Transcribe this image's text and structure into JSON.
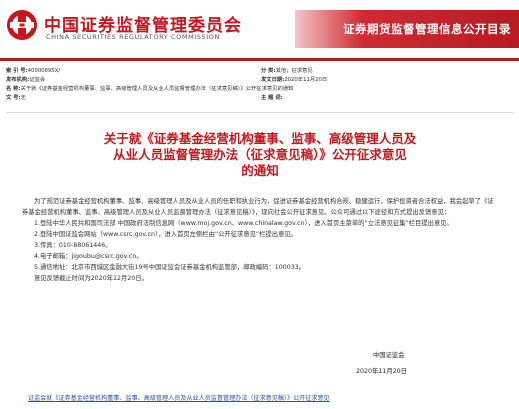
{
  "header": {
    "org_cn": "中国证券监督管理委员会",
    "org_en": "CHINA SECURITIES REGULATORY COMMISSION",
    "banner": "证券期货监督管理信息公开目录",
    "brand_color": "#c8161d"
  },
  "meta": {
    "index_label": "索 引 号:",
    "index_value": "40000895X/",
    "category_label": "分 类:",
    "category_value": "其他；征求意见",
    "issuer_label": "发布机构:",
    "issuer_value": "证监会",
    "date_label": "发文日期:",
    "date_value": "2020年11月20日",
    "name_label": "名 称:",
    "name_value": "关于就《证券基金经营机构董事、监事、高级管理人员及从业人员监督管理办法（征求意见稿）》公开征求意见的通知",
    "docno_label": "文 号:",
    "docno_value": "无",
    "subject_label": "主 题 词:",
    "subject_value": ""
  },
  "title": {
    "line1": "关于就《证券基金经营机构董事、监事、高级管理人员及",
    "line2": "从业人员监督管理办法（征求意见稿）》公开征求意见",
    "line3": "的通知"
  },
  "body": {
    "intro": "为了规范证券基金经营机构董事、监事、高级管理人员及从业人员的任职和执业行为，促进证券基金经营机构合规、稳健运行，保护投资者合法权益，我会起草了《证券基金经营机构董事、监事、高级管理人员及从业人员监督管理办法（征求意见稿）》，现向社会公开征求意见。公众可通过以下途径和方式提出反馈意见：",
    "item1": "1.登陆中华人民共和国司法部 中国政府法制信息网（www.moj.gov.cn、www.chinalaw.gov.cn），进入首页主菜单的“立法意见征集”栏目提出意见。",
    "item2": "2.登陆中国证监会网站（www.csrc.gov.cn），进入首页左侧栏由“公开征求意见”栏提出意见。",
    "item3": "3.传真：010-88061446。",
    "item4": "4.电子邮箱：jigoubu@csrc.gov.cn。",
    "item5": "5.通信地址：北京市西城区金融大街19号中国证监会证券基金机构监管部，邮政编码：100033。",
    "deadline": "意见反馈截止时间为2020年12月20日。",
    "signer": "中国证监会",
    "sign_date": "2020年11月20日"
  },
  "footer": {
    "link": "证监会就《证券基金经营机构董事、监事、高级管理人员及从业人员监督管理办法（征求意见稿）》公开征求意见"
  }
}
